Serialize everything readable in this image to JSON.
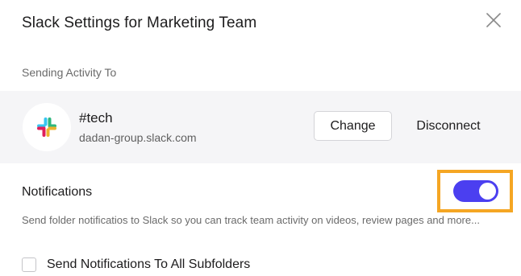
{
  "dialog": {
    "title": "Slack Settings for Marketing Team",
    "close_icon": "close-icon"
  },
  "activity": {
    "section_label": "Sending Activity To",
    "icon": "slack-logo-icon",
    "channel": "#tech",
    "workspace": "dadan-group.slack.com",
    "change_label": "Change",
    "disconnect_label": "Disconnect"
  },
  "notifications": {
    "title": "Notifications",
    "enabled": true,
    "description": "Send folder notificatios to Slack so you can track team activity on videos, review pages and more...",
    "toggle_color": "#4b3ff0",
    "highlight_color": "#f5a623"
  },
  "subfolders": {
    "checked": false,
    "label": "Send Notifications To All Subfolders"
  }
}
